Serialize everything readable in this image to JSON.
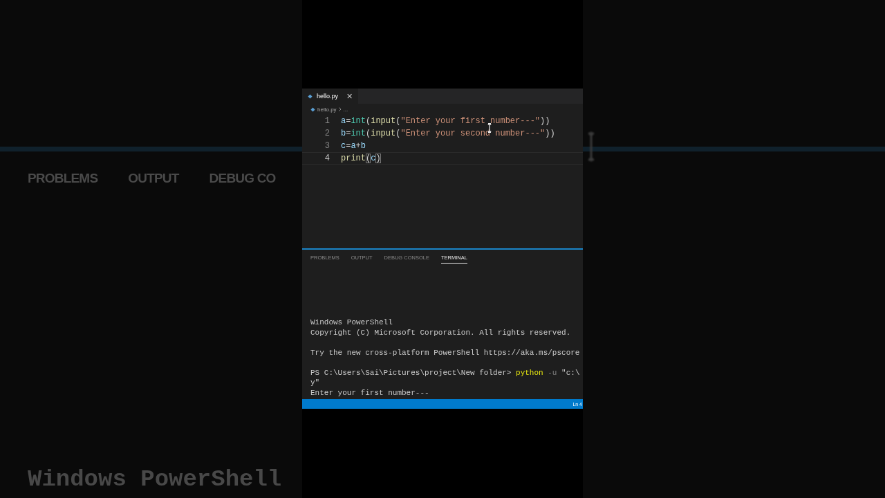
{
  "backdrop": {
    "panel_tabs": [
      "PROBLEMS",
      "OUTPUT",
      "DEBUG CO"
    ],
    "terminal_text": "Windows PowerShell"
  },
  "editor": {
    "tabs": [
      {
        "label": "hello.py",
        "selected": true,
        "close": "✕"
      }
    ],
    "breadcrumb": [
      "hello.py",
      "..."
    ],
    "lines": [
      {
        "number": "1",
        "active": false,
        "tokens": [
          {
            "text": "a",
            "kind": "var"
          },
          {
            "text": "=",
            "kind": "punct"
          },
          {
            "text": "int",
            "kind": "type"
          },
          {
            "text": "(",
            "kind": "punct"
          },
          {
            "text": "input",
            "kind": "func"
          },
          {
            "text": "(",
            "kind": "punct"
          },
          {
            "text": "\"Enter your first number---\"",
            "kind": "string"
          },
          {
            "text": "))",
            "kind": "punct"
          }
        ]
      },
      {
        "number": "2",
        "active": false,
        "tokens": [
          {
            "text": "b",
            "kind": "var"
          },
          {
            "text": "=",
            "kind": "punct"
          },
          {
            "text": "int",
            "kind": "type"
          },
          {
            "text": "(",
            "kind": "punct"
          },
          {
            "text": "input",
            "kind": "func"
          },
          {
            "text": "(",
            "kind": "punct"
          },
          {
            "text": "\"Enter your second number---\"",
            "kind": "string"
          },
          {
            "text": "))",
            "kind": "punct"
          }
        ]
      },
      {
        "number": "3",
        "active": false,
        "tokens": [
          {
            "text": "c",
            "kind": "var"
          },
          {
            "text": "=",
            "kind": "punct"
          },
          {
            "text": "a",
            "kind": "var"
          },
          {
            "text": "+",
            "kind": "punct"
          },
          {
            "text": "b",
            "kind": "var"
          }
        ]
      },
      {
        "number": "4",
        "active": true,
        "tokens": [
          {
            "text": "print",
            "kind": "func"
          },
          {
            "text": "(",
            "kind": "match"
          },
          {
            "text": "c",
            "kind": "var"
          },
          {
            "text": ")",
            "kind": "match"
          }
        ]
      }
    ]
  },
  "panel": {
    "tabs": [
      {
        "label": "PROBLEMS",
        "selected": false
      },
      {
        "label": "OUTPUT",
        "selected": false
      },
      {
        "label": "DEBUG CONSOLE",
        "selected": false
      },
      {
        "label": "TERMINAL",
        "selected": true
      }
    ],
    "terminal": [
      {
        "kind": "text",
        "segments": [
          {
            "text": "Windows PowerShell",
            "kind": "plain"
          }
        ]
      },
      {
        "kind": "text",
        "segments": [
          {
            "text": "Copyright (C) Microsoft Corporation. All rights reserved.",
            "kind": "plain"
          }
        ]
      },
      {
        "kind": "blank"
      },
      {
        "kind": "text",
        "segments": [
          {
            "text": "Try the new cross-platform PowerShell https://aka.ms/pscore",
            "kind": "plain"
          }
        ]
      },
      {
        "kind": "blank"
      },
      {
        "kind": "text",
        "segments": [
          {
            "text": "PS C:\\Users\\Sai\\Pictures\\project\\New folder> ",
            "kind": "plain"
          },
          {
            "text": "python",
            "kind": "command"
          },
          {
            "text": " -u ",
            "kind": "flag"
          },
          {
            "text": "\"c:\\",
            "kind": "plain"
          }
        ]
      },
      {
        "kind": "text",
        "segments": [
          {
            "text": "y\"",
            "kind": "plain"
          }
        ]
      },
      {
        "kind": "text",
        "segments": [
          {
            "text": "Enter your first number---",
            "kind": "plain"
          }
        ]
      }
    ]
  },
  "status_bar": {
    "position": "Ln 4"
  }
}
